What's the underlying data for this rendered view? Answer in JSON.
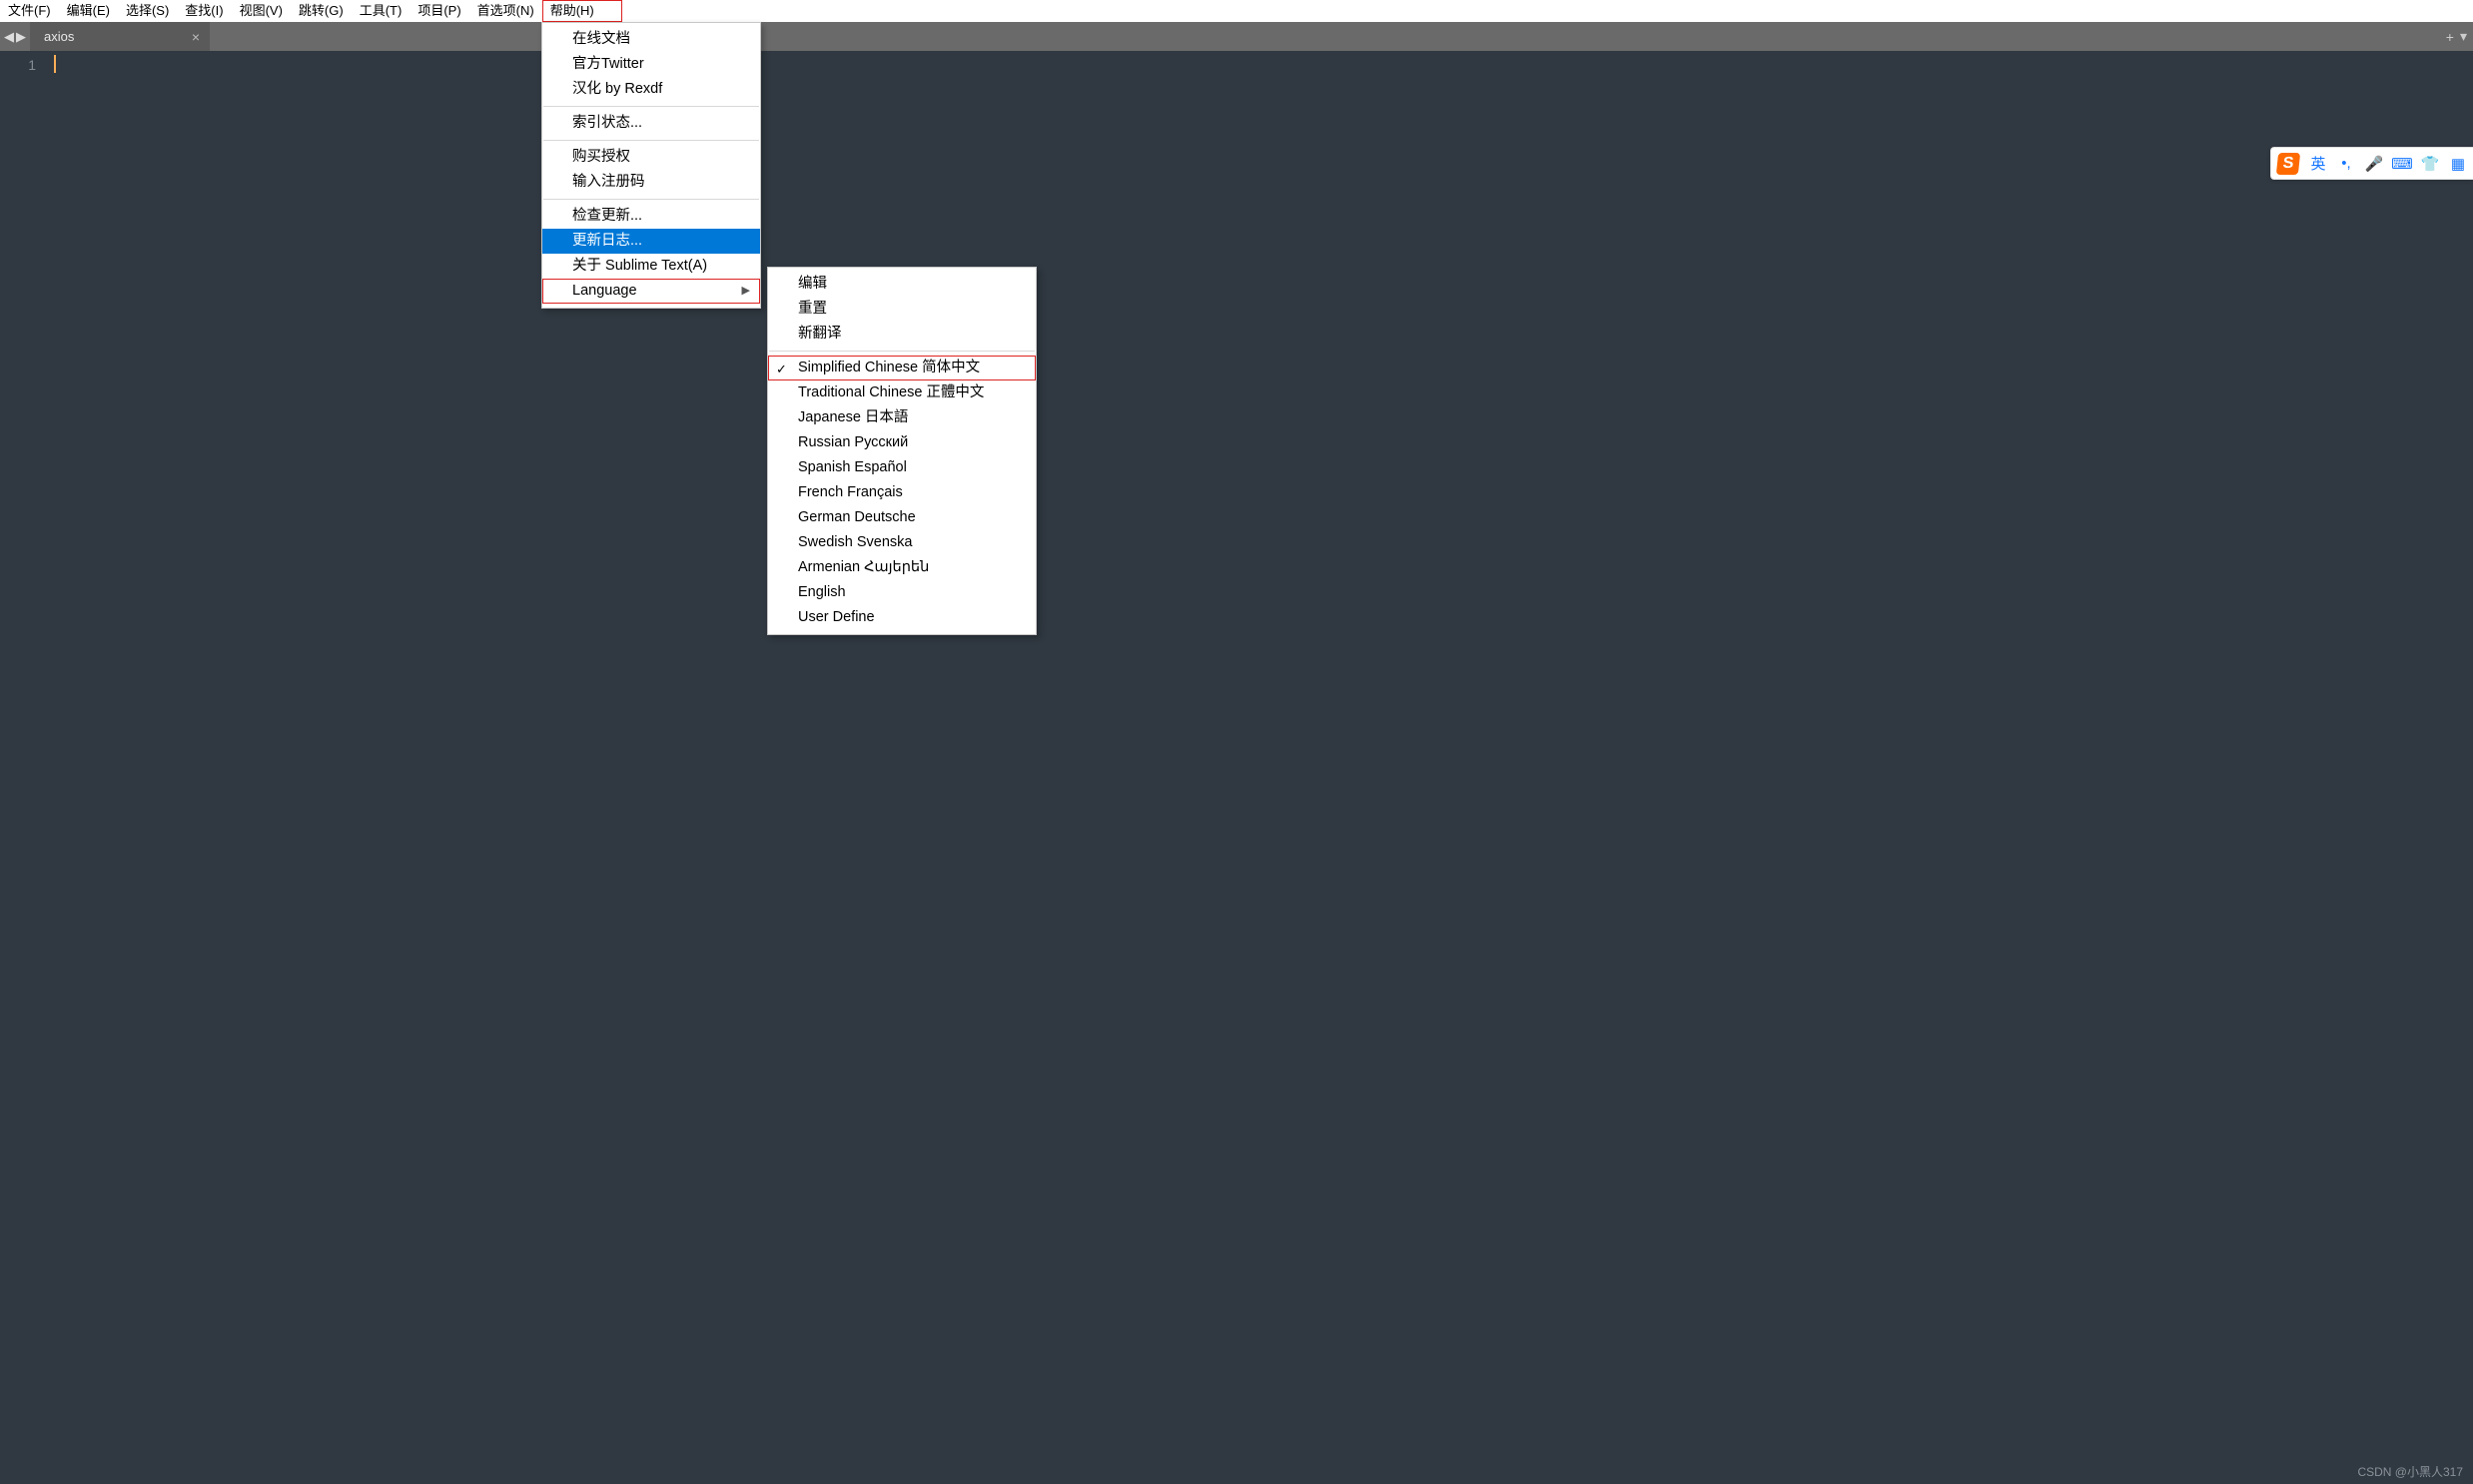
{
  "menubar": {
    "items": [
      {
        "label": "文件(F)"
      },
      {
        "label": "编辑(E)"
      },
      {
        "label": "选择(S)"
      },
      {
        "label": "查找(I)"
      },
      {
        "label": "视图(V)"
      },
      {
        "label": "跳转(G)"
      },
      {
        "label": "工具(T)"
      },
      {
        "label": "项目(P)"
      },
      {
        "label": "首选项(N)"
      },
      {
        "label": "帮助(H)",
        "highlighted": true
      }
    ]
  },
  "tabs": {
    "active": {
      "title": "axios"
    },
    "nav_back": "◀",
    "nav_fwd": "▶",
    "new_tab": "+",
    "overflow": "▾"
  },
  "editor": {
    "line_numbers": [
      "1"
    ]
  },
  "help_menu": {
    "groups": [
      [
        {
          "label": "在线文档"
        },
        {
          "label": "官方Twitter"
        },
        {
          "label": "汉化 by Rexdf"
        }
      ],
      [
        {
          "label": "索引状态..."
        }
      ],
      [
        {
          "label": "购买授权"
        },
        {
          "label": "输入注册码"
        }
      ],
      [
        {
          "label": "检查更新..."
        },
        {
          "label": "更新日志...",
          "selected": true
        },
        {
          "label": "关于 Sublime Text(A)"
        },
        {
          "label": "Language",
          "submenu": true,
          "highlighted": true
        }
      ]
    ]
  },
  "lang_menu": {
    "groups": [
      [
        {
          "label": "编辑"
        },
        {
          "label": "重置"
        },
        {
          "label": "新翻译"
        }
      ],
      [
        {
          "label": "Simplified Chinese 简体中文",
          "checked": true,
          "highlighted": true
        },
        {
          "label": "Traditional Chinese 正體中文"
        },
        {
          "label": "Japanese 日本語"
        },
        {
          "label": "Russian Русский"
        },
        {
          "label": "Spanish Español"
        },
        {
          "label": "French Français"
        },
        {
          "label": "German Deutsche"
        },
        {
          "label": "Swedish Svenska"
        },
        {
          "label": "Armenian Հայերեն"
        },
        {
          "label": "English"
        },
        {
          "label": "User Define"
        }
      ]
    ]
  },
  "ime": {
    "logo": "S",
    "lang": "英",
    "punct": "•,",
    "mic": "🎤",
    "keyboard": "⌨",
    "skin": "👕",
    "grid": "▦"
  },
  "watermark": "CSDN @小黑人317"
}
